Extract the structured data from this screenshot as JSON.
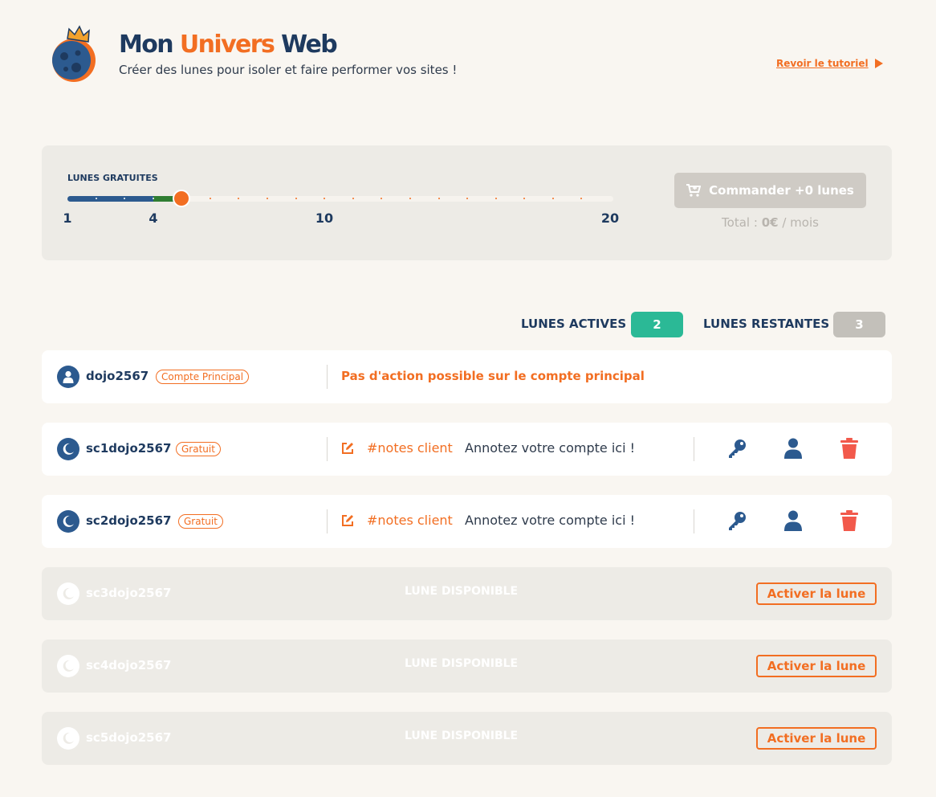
{
  "header": {
    "brand_part1": "Mon",
    "brand_part2": "Univers",
    "brand_part3": "Web",
    "tagline": "Créer des lunes pour isoler et faire performer vos sites !",
    "tutorial_link": "Revoir le tutoriel"
  },
  "slider": {
    "title": "LUNES GRATUITES",
    "min": 1,
    "max": 20,
    "free_limit": 4,
    "value": 5,
    "tick_labels": [
      "1",
      "4",
      "10",
      "20"
    ],
    "order_button": "Commander +0 lunes",
    "total_prefix": "Total :",
    "total_amount": "0€",
    "total_suffix": "/ mois"
  },
  "counters": {
    "active_label": "LUNES ACTIVES",
    "active_count": "2",
    "remaining_label": "LUNES RESTANTES",
    "remaining_count": "3"
  },
  "accounts": [
    {
      "name": "dojo2567",
      "tag": "Compte Principal",
      "message": "Pas d'action possible sur le compte principal"
    },
    {
      "name": "sc1dojo2567",
      "tag": "Gratuit",
      "note_tag": "#notes client",
      "note_text": "Annotez votre compte ici !"
    },
    {
      "name": "sc2dojo2567",
      "tag": "Gratuit",
      "note_tag": "#notes client",
      "note_text": "Annotez votre compte ici !"
    },
    {
      "name": "sc3dojo2567",
      "status": "LUNE DISPONIBLE",
      "action": "Activer la lune"
    },
    {
      "name": "sc4dojo2567",
      "status": "LUNE DISPONIBLE",
      "action": "Activer la lune"
    },
    {
      "name": "sc5dojo2567",
      "status": "LUNE DISPONIBLE",
      "action": "Activer la lune"
    }
  ],
  "colors": {
    "accent": "#f26e22",
    "navy": "#1e3a5f",
    "active_badge": "#2bb996",
    "remaining_badge": "#c3c0ba",
    "delete": "#f2594b",
    "background": "#f9f6f1"
  },
  "icons": [
    "planet-logo-icon",
    "play-triangle-icon",
    "cart-icon",
    "user-icon",
    "moon-icon",
    "edit-icon",
    "key-icon",
    "trash-icon"
  ]
}
